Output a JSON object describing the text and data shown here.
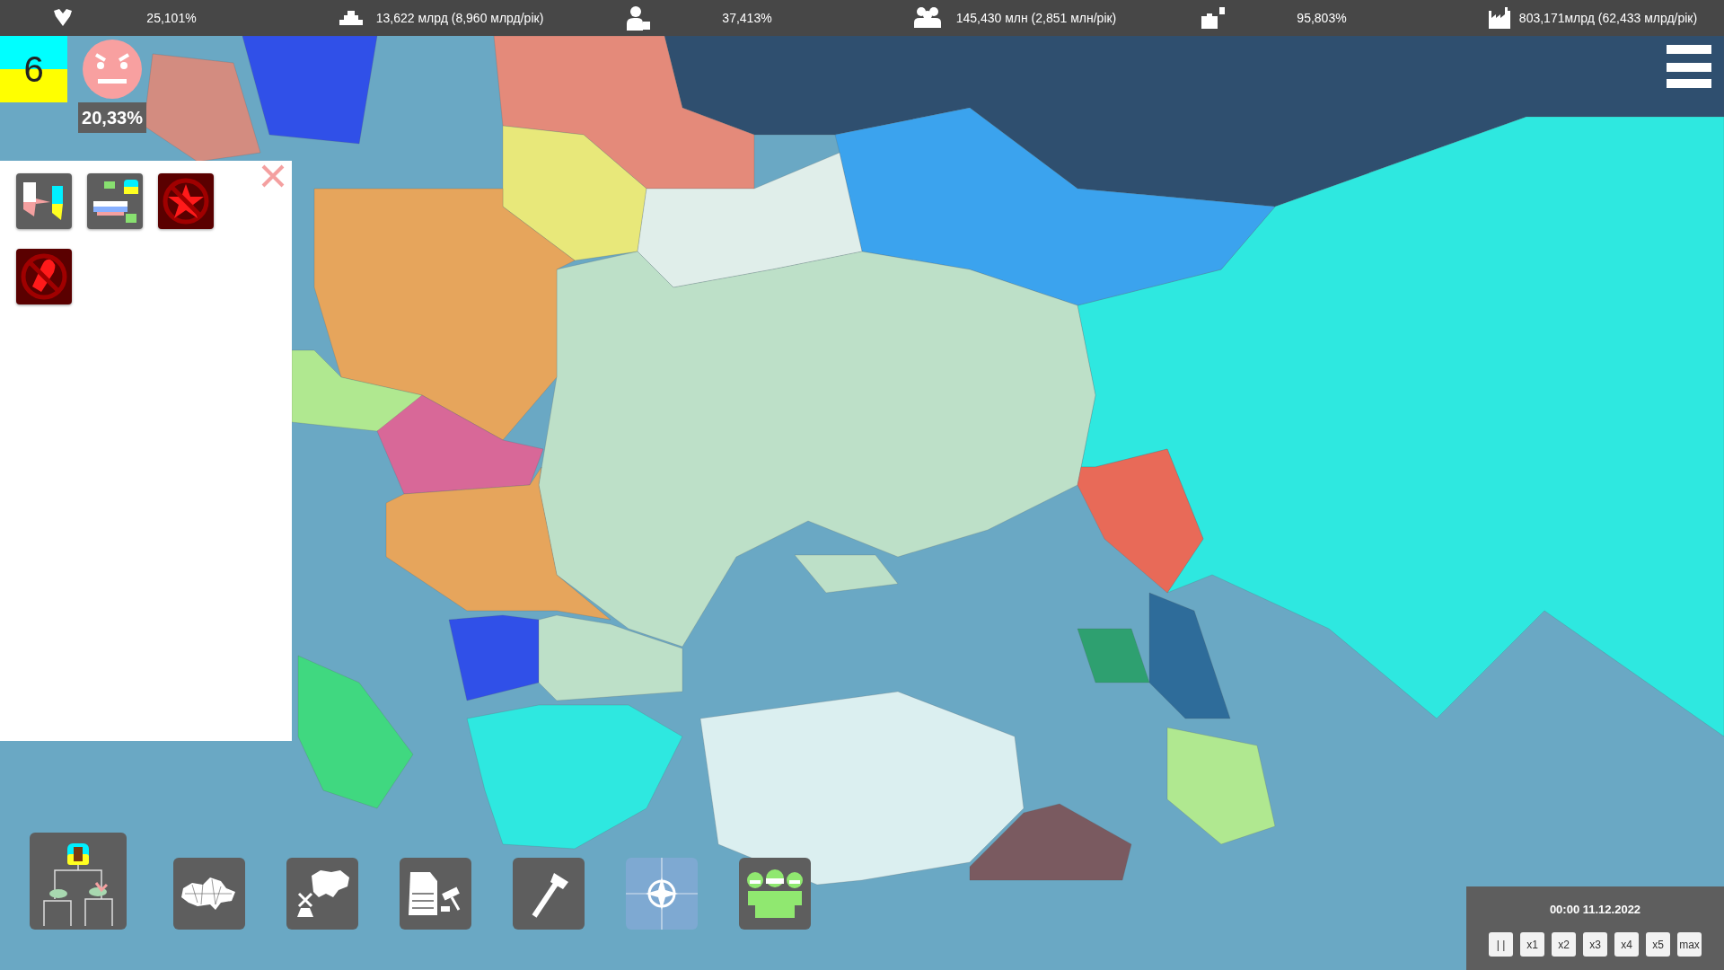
{
  "top_bar": [
    {
      "kind": "approval",
      "value": "25,101%"
    },
    {
      "kind": "money",
      "value": "13,622 млрд (8,960 млрд/рік)"
    },
    {
      "kind": "employment",
      "value": "37,413%"
    },
    {
      "kind": "population",
      "value": "145,430 млн (2,851 млн/рік)"
    },
    {
      "kind": "business",
      "value": "95,803%"
    },
    {
      "kind": "industry",
      "value": "803,171млрд (62,433 млрд/рік)"
    }
  ],
  "country": {
    "rank": "6"
  },
  "mood": {
    "kind": "angry",
    "value": "20,33%"
  },
  "side_panel": {
    "items": [
      {
        "kind": "partition"
      },
      {
        "kind": "annex"
      },
      {
        "kind": "ban-star"
      },
      {
        "kind": "ban-rocket"
      }
    ]
  },
  "toolbar": [
    {
      "kind": "elections",
      "disabled": false
    },
    {
      "kind": "regions",
      "disabled": false
    },
    {
      "kind": "split",
      "disabled": false
    },
    {
      "kind": "laws",
      "disabled": false
    },
    {
      "kind": "build",
      "disabled": false
    },
    {
      "kind": "alliance",
      "disabled": true
    },
    {
      "kind": "population",
      "disabled": false
    }
  ],
  "clock": {
    "time": "00:00 11.12.2022",
    "speeds": [
      "| |",
      "x1",
      "x2",
      "x3",
      "x4",
      "x5",
      "max"
    ]
  }
}
